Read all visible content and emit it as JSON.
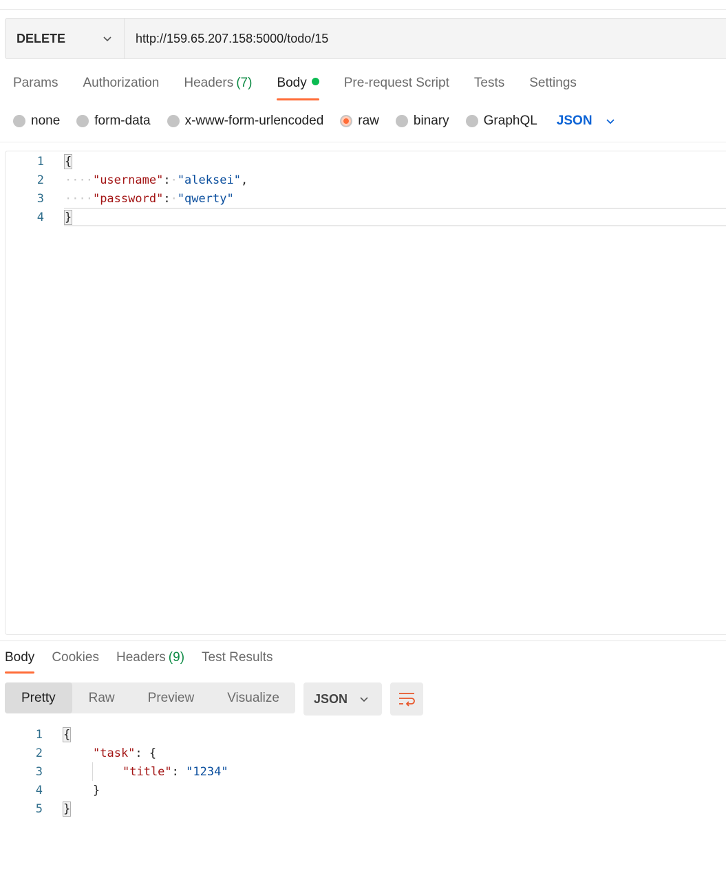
{
  "request": {
    "method": "DELETE",
    "url": "http://159.65.207.158:5000/todo/15",
    "tabs": [
      {
        "label": "Params",
        "count": ""
      },
      {
        "label": "Authorization",
        "count": ""
      },
      {
        "label": "Headers",
        "count": "(7)"
      },
      {
        "label": "Body",
        "count": ""
      },
      {
        "label": "Pre-request Script",
        "count": ""
      },
      {
        "label": "Tests",
        "count": ""
      },
      {
        "label": "Settings",
        "count": ""
      }
    ],
    "active_tab": "Body",
    "body_types": [
      "none",
      "form-data",
      "x-www-form-urlencoded",
      "raw",
      "binary",
      "GraphQL"
    ],
    "selected_body_type": "raw",
    "language": "JSON",
    "editor": {
      "line_numbers": [
        "1",
        "2",
        "3",
        "4"
      ],
      "open_brace": "{",
      "close_brace": "}",
      "key1": "\"username\"",
      "val1": "\"aleksei\"",
      "key2": "\"password\"",
      "val2": "\"qwerty\""
    }
  },
  "response": {
    "tabs": [
      {
        "label": "Body",
        "count": ""
      },
      {
        "label": "Cookies",
        "count": ""
      },
      {
        "label": "Headers",
        "count": "(9)"
      },
      {
        "label": "Test Results",
        "count": ""
      }
    ],
    "active_tab": "Body",
    "views": [
      "Pretty",
      "Raw",
      "Preview",
      "Visualize"
    ],
    "active_view": "Pretty",
    "format": "JSON",
    "code": {
      "line_numbers": [
        "1",
        "2",
        "3",
        "4",
        "5"
      ],
      "open_brace": "{",
      "close_brace": "}",
      "task_key": "\"task\"",
      "title_key": "\"title\"",
      "title_val": "\"1234\""
    }
  },
  "colors": {
    "accent": "#ff6c37",
    "dot_green": "#0cbb52",
    "link_blue": "#0d64d6"
  }
}
